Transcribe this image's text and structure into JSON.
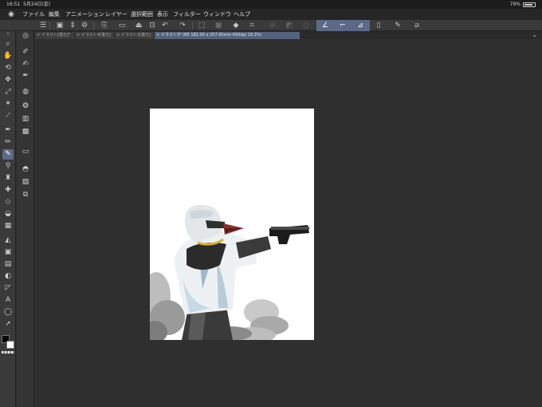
{
  "status": {
    "time": "16:51",
    "date": "5月24日(金)",
    "battery": "79%"
  },
  "menu": {
    "items": [
      "ファイル",
      "編集",
      "アニメーション",
      "レイヤー",
      "選択範囲",
      "表示",
      "フィルター",
      "ウィンドウ",
      "ヘルプ"
    ]
  },
  "tabs": [
    {
      "label": "イラスト[復元]*"
    },
    {
      "label": "イラスト4[復元]"
    },
    {
      "label": "イラスト2[復元]"
    },
    {
      "label": "イラスト3* (B5 182.00 x 257.00mm 600dpi 18.3%)"
    }
  ],
  "colors": {
    "accent": "#5b6a86",
    "tab_active": "#54627c"
  },
  "icons": {
    "main_tools": [
      "search-icon",
      "hand-icon",
      "zoom-rotate-icon",
      "move-icon",
      "transform-icon",
      "magic-wand-icon",
      "eyedropper-icon",
      "pen-icon",
      "pencil-icon",
      "brush-icon",
      "airbrush-icon",
      "decoration-icon",
      "blend-icon",
      "eraser-icon",
      "fill-icon",
      "gradient-icon",
      "frame-icon",
      "ruler-icon",
      "text-icon",
      "balloon-icon",
      "lasso-icon",
      "correct-line-icon"
    ],
    "sub_tools": [
      "navigator-icon",
      "layer-property-icon",
      "layer-search-icon",
      "tone-icon",
      "color-wheel-icon",
      "color-slider-icon",
      "color-set-icon",
      "intermediate-color-icon",
      "approximate-color-icon",
      "color-history-icon",
      "layer-icon",
      "material-icon",
      "sub-view-icon"
    ]
  }
}
